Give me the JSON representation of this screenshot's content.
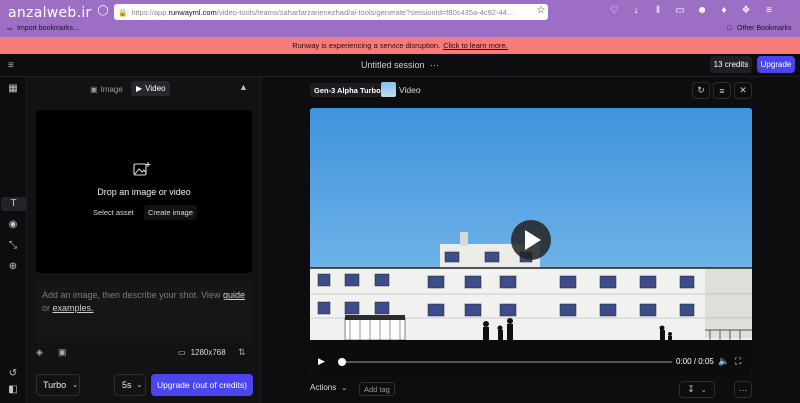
{
  "browser": {
    "url_prefix": "https://app.",
    "url_domain": "runwayml.com",
    "url_rest": "/video-tools/teams/saharfarzanenezhad/ai-tools/generate?sessionId=f80c435a-4c92-44...",
    "bookmarks_left": "Import bookmarks...",
    "bookmarks_right": "Other Bookmarks",
    "watermark": "anzalweb.ir"
  },
  "alert": {
    "message": "Runway is experiencing a service disruption.",
    "link": "Click to learn more."
  },
  "header": {
    "session_title": "Untitled session",
    "session_more": "···",
    "credits": "13 credits",
    "upgrade": "Upgrade"
  },
  "left_panel": {
    "tab_image": "Image",
    "tab_video": "Video",
    "drop_text": "Drop an image or video",
    "select_asset": "Select asset",
    "create_image": "Create image",
    "prompt_prefix": "Add an image, then describe your shot. View ",
    "prompt_link1": "guide",
    "prompt_mid": " or ",
    "prompt_link2": "examples.",
    "resolution": "1280x768",
    "model": "Turbo",
    "duration": "5s",
    "generate_button": "Upgrade",
    "generate_suffix": "(out of credits)"
  },
  "right_panel": {
    "model_badge": "Gen-3 Alpha Turbo",
    "media_label": "Video",
    "time_current": "0:00",
    "time_sep": "/",
    "time_total": "0:05",
    "actions": "Actions",
    "add_tag": "Add tag",
    "progress_fraction": 0.0
  },
  "colors": {
    "browser_bg": "#9c6fc4",
    "alert_bg": "#f87b7b",
    "accent": "#4b45f0",
    "sky": "#5aa6e4"
  }
}
